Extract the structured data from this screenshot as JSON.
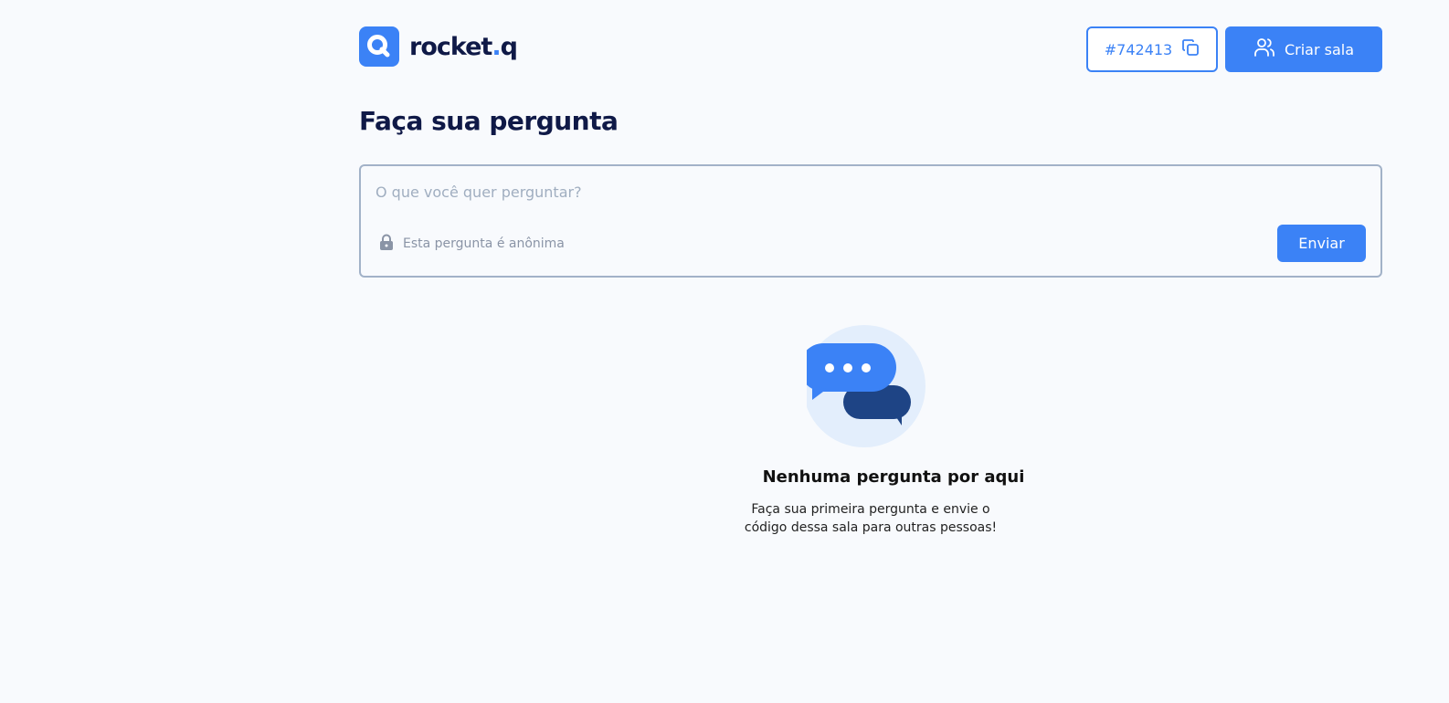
{
  "header": {
    "logo_text_main": "rocket",
    "logo_text_dot": ".",
    "logo_text_suffix": "q",
    "room_code": "#742413",
    "create_room_label": "Criar sala"
  },
  "main": {
    "title": "Faça sua pergunta",
    "question_placeholder": "O que você quer perguntar?",
    "anonymous_label": "Esta pergunta é anônima",
    "send_label": "Enviar"
  },
  "empty_state": {
    "title": "Nenhuma pergunta por aqui",
    "description": "Faça sua primeira pergunta e envie o código dessa sala para outras pessoas!"
  },
  "colors": {
    "primary": "#3b82f6",
    "dark_navy": "#0f1947",
    "background": "#f8fafd",
    "border": "#a2b2c8"
  },
  "icons": {
    "logo": "rocketq-logo-icon",
    "copy": "copy-icon",
    "users": "users-icon",
    "lock": "lock-icon",
    "chat": "chat-bubbles-icon"
  }
}
